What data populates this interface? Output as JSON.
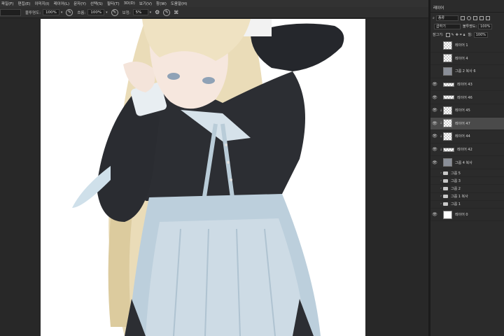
{
  "menu": [
    "파일(F)",
    "편집(E)",
    "이미지(I)",
    "레이어(L)",
    "문자(Y)",
    "선택(S)",
    "필터(T)",
    "3D(D)",
    "보기(V)",
    "창(W)",
    "도움말(H)"
  ],
  "options": {
    "opacity_label": "불투명도:",
    "opacity_value": "100%",
    "flow_label": "흐름:",
    "flow_value": "100%",
    "smooth_label": "보정:",
    "smooth_value": "5%"
  },
  "panel": {
    "tab": "레이어",
    "filter_kind": "종류",
    "blend_mode": "곱하기",
    "opacity_label": "불투명도:",
    "opacity_value": "100%",
    "lock_label": "잠그기:",
    "fill_label": "칠:",
    "fill_value": "100%"
  },
  "layers": [
    {
      "name": "레이어 1",
      "visible": false,
      "kind": "checker"
    },
    {
      "name": "레이어 4",
      "visible": false,
      "kind": "checker"
    },
    {
      "name": "그룹 2 복사 6",
      "visible": false,
      "kind": "pic"
    },
    {
      "name": "레이어 43",
      "visible": true,
      "kind": "wide"
    },
    {
      "name": "레이어 46",
      "visible": true,
      "kind": "wide"
    },
    {
      "name": "레이어 45",
      "visible": true,
      "kind": "checker",
      "clipped": true
    },
    {
      "name": "레이어 47",
      "visible": true,
      "kind": "checker",
      "clipped": true,
      "selected": true
    },
    {
      "name": "레이어 44",
      "visible": true,
      "kind": "checker",
      "clipped": true
    },
    {
      "name": "레이어 42",
      "visible": true,
      "kind": "wide",
      "clipped": true
    },
    {
      "name": "그룹 4 복사",
      "visible": true,
      "kind": "pic"
    },
    {
      "name": "그룹 5",
      "visible": false,
      "kind": "folder"
    },
    {
      "name": "그룹 3",
      "visible": false,
      "kind": "folder"
    },
    {
      "name": "그룹 2",
      "visible": false,
      "kind": "folder"
    },
    {
      "name": "그룹 1 복사",
      "visible": false,
      "kind": "folder"
    },
    {
      "name": "그룹 1",
      "visible": false,
      "kind": "folder"
    },
    {
      "name": "레이어 0",
      "visible": true,
      "kind": "white"
    }
  ]
}
